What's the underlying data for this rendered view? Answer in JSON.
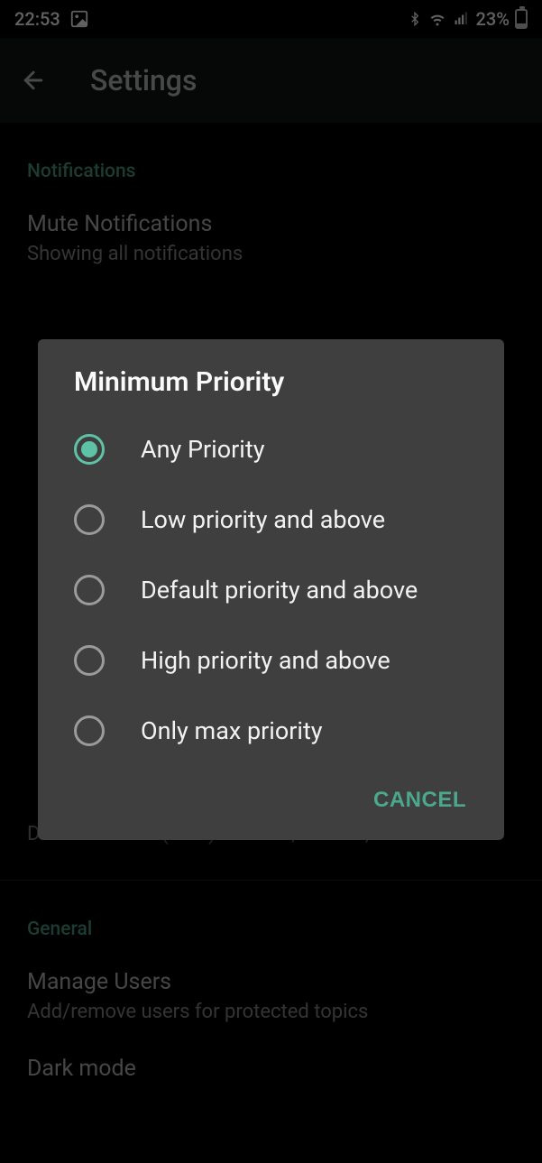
{
  "status": {
    "time": "22:53",
    "battery_pct": "23%"
  },
  "appbar": {
    "title": "Settings"
  },
  "sections": {
    "notifications_header": "Notifications",
    "mute": {
      "title": "Mute Notifications",
      "sub": "Showing all notifications"
    },
    "dnd_sub": "Do Not Disturb (DND) override, sounds, etc.",
    "general_header": "General",
    "manage_users": {
      "title": "Manage Users",
      "sub": "Add/remove users for protected topics"
    },
    "dark_mode": {
      "title": "Dark mode"
    }
  },
  "dialog": {
    "title": "Minimum Priority",
    "options": {
      "any": "Any Priority",
      "low": "Low priority and above",
      "default": "Default priority and above",
      "high": "High priority and above",
      "max": "Only max priority"
    },
    "selected": "any",
    "cancel": "CANCEL"
  }
}
